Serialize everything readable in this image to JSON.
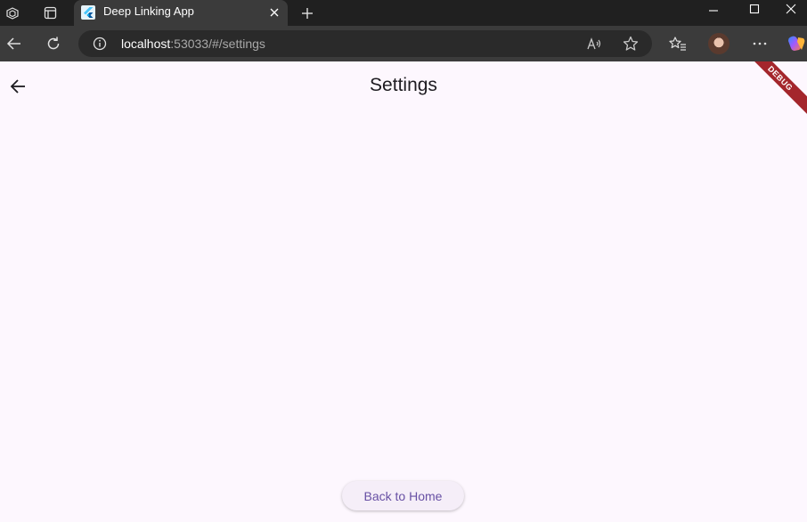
{
  "browser": {
    "tab": {
      "title": "Deep Linking App",
      "favicon": "flutter-logo-icon"
    },
    "address_bar": {
      "host": "localhost",
      "rest": ":53033/#/settings"
    },
    "icons": {
      "workspaces": "workspaces-icon",
      "tab_actions": "tab-actions-icon",
      "new_tab": "plus-icon",
      "minimize": "minimize-icon",
      "maximize": "maximize-icon",
      "close": "close-icon",
      "back": "back-arrow-icon",
      "refresh": "refresh-icon",
      "info": "info-icon",
      "read_aloud": "read-aloud-icon",
      "favorite": "star-icon",
      "favorites": "favorites-icon",
      "more": "more-icon",
      "copilot": "copilot-icon"
    },
    "colors": {
      "tab_strip": "#202020",
      "toolbar": "#3b3b3b",
      "address_bg": "#2a2a2a"
    }
  },
  "app": {
    "title": "Settings",
    "debug_banner": "DEBUG",
    "back_home_label": "Back to Home",
    "colors": {
      "background": "#fdf7fe",
      "primary": "#6750a4",
      "banner": "#a4262c"
    }
  }
}
